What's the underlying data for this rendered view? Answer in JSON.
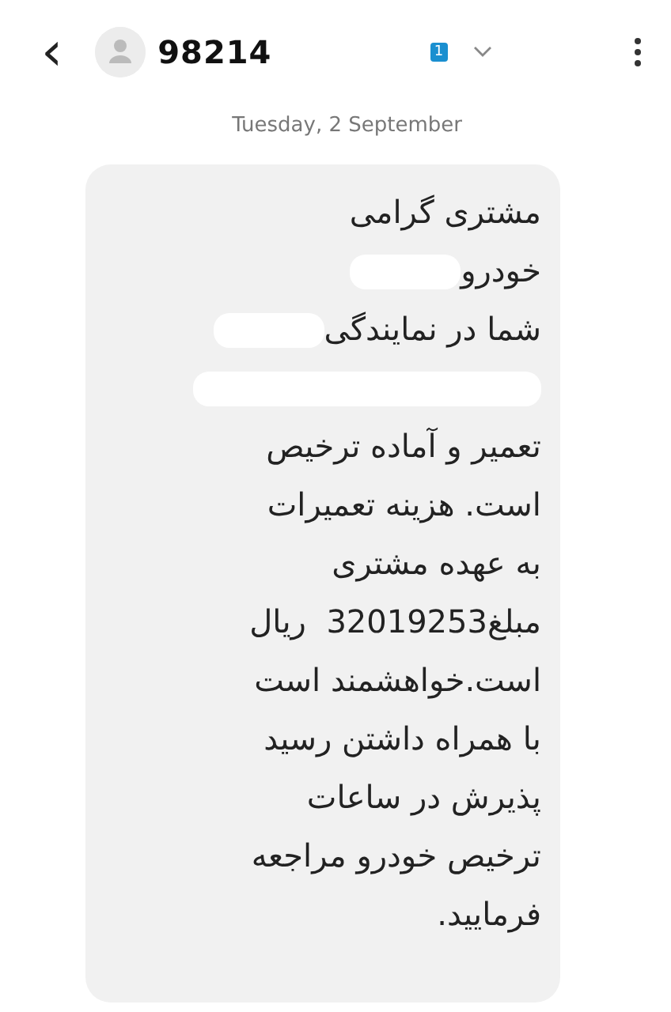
{
  "header": {
    "back": "‹",
    "contact": "98214",
    "sim_badge": "1"
  },
  "date": "Tuesday, 2 September",
  "message": {
    "lines": [
      {
        "text": "مشتری گرامی",
        "redacted": false
      },
      {
        "text": "خودرو",
        "redacted": true
      },
      {
        "text": "شما در نمایندگی",
        "redacted": true
      },
      {
        "redacted": true
      },
      {
        "text": "تعمیر و آماده ترخیص",
        "redacted": false
      },
      {
        "text": "است. هزینه تعمیرات",
        "redacted": false
      },
      {
        "text": "به عهده مشتری",
        "redacted": false
      },
      {
        "text": "مبلغ32019253  ریال",
        "redacted": false
      },
      {
        "text": "است.خواهشمند است",
        "redacted": false
      },
      {
        "text": "با همراه داشتن رسید",
        "redacted": false
      },
      {
        "text": "پذیرش در ساعات",
        "redacted": false
      },
      {
        "text": "ترخیص خودرو مراجعه",
        "redacted": false
      },
      {
        "text": "فرمایید.",
        "redacted": false
      }
    ]
  }
}
